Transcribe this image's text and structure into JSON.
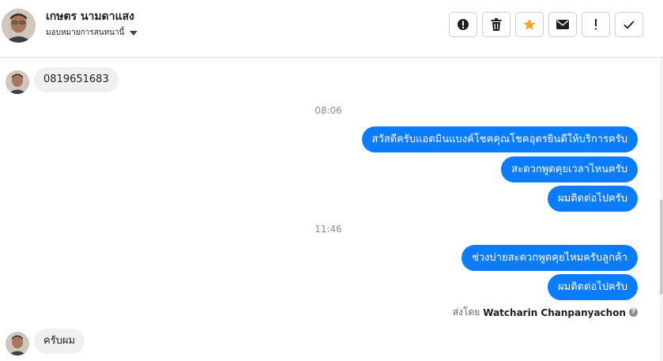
{
  "header": {
    "contact_name": "เกษตร นามดาแสง",
    "assign_label": "มอบหมายการสนทนานี้"
  },
  "actions": [
    {
      "name": "spam",
      "icon": "alert-circle-icon"
    },
    {
      "name": "delete",
      "icon": "trash-icon"
    },
    {
      "name": "star",
      "icon": "star-icon"
    },
    {
      "name": "unread",
      "icon": "envelope-icon"
    },
    {
      "name": "follow-up",
      "icon": "exclamation-icon"
    },
    {
      "name": "done",
      "icon": "checkmark-icon"
    }
  ],
  "colors": {
    "outgoing_bubble": "#0a7cff",
    "incoming_bubble": "#f0f0f0",
    "star": "#f5a623"
  },
  "messages": {
    "incoming_phone": "0819651683",
    "time_1": "08:06",
    "out_1": "สวัสดีครับแอดมินแบงค์โชคคุณโชคอุดรยินดีให้บริการครับ",
    "out_2": "สะดวกพูดคุยเวลาไหนครับ",
    "out_3": "ผมติดต่อไปครับ",
    "time_2": "11:46",
    "out_4": "ช่วงบ่ายสะดวกพูดคุยไหมครับลูกค้า",
    "out_5": "ผมติดต่อไปครับ",
    "sent_by_prefix": "ส่งโดย",
    "sent_by_name": "Watcharin Chanpanyachon",
    "incoming_reply": "ครับผม"
  }
}
